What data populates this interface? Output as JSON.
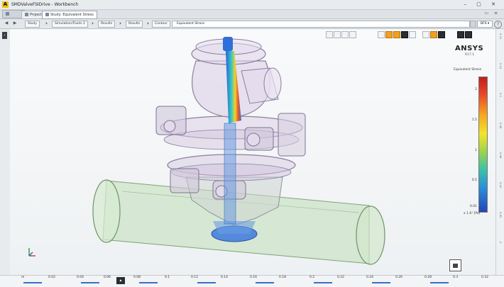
{
  "window": {
    "app_logo": "A",
    "title": "SMDValveFSIDrive - Workbench",
    "controls": "– ▢ ✕"
  },
  "tabs": [
    {
      "label": "Project"
    },
    {
      "label": "Study: Equivalent Stress"
    }
  ],
  "breadcrumb": {
    "items": [
      "Study",
      "Simulation/Fluids 2",
      "Results",
      "Results",
      "Contour"
    ],
    "current": "Equivalent Stress",
    "lang": "DFS ▾",
    "help": "?"
  },
  "brand": {
    "name": "ANSYS",
    "version": "R17.1"
  },
  "legend": {
    "title": "Equivalent Stress",
    "ticks": [
      "2",
      "1.5",
      "1",
      "0.5",
      "0.01"
    ],
    "unit": "x 1.6¹ [Pa]"
  },
  "right_ticks": [
    "0.14",
    "0.12",
    "0.1",
    "0.08",
    "0.06",
    "0.04",
    "0.02",
    "0"
  ],
  "bottom_ticks": [
    "m",
    "0.02",
    "0.04",
    "0.06",
    "0.08",
    "0.1",
    "0.12",
    "0.14",
    "0.16",
    "0.18",
    "0.2",
    "0.22",
    "0.24",
    "0.26",
    "0.28",
    "0.3",
    "0.32"
  ],
  "colors": {
    "accent": "#f0a020",
    "pipe": "#b9d9b3",
    "valve": "#cdbcd8",
    "stress_blue": "#2f6fd8"
  },
  "icons": [
    "back-arrow-icon",
    "forward-arrow-icon",
    "chevron-right-icon",
    "view-tool-icon",
    "camera-icon",
    "axis-triad-icon",
    "collapse-icon"
  ]
}
